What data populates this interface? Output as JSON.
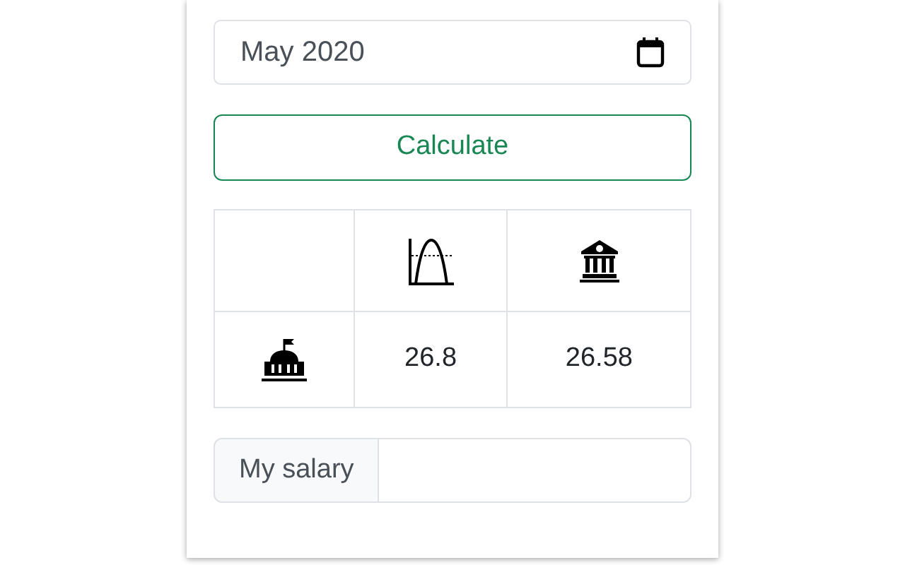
{
  "date_field": {
    "value": "May 2020"
  },
  "calculate_button": {
    "label": "Calculate"
  },
  "table": {
    "columns": [
      {
        "kind": "blank"
      },
      {
        "kind": "chart"
      },
      {
        "kind": "bank"
      }
    ],
    "rows": [
      {
        "kind": "capitol",
        "cells": [
          "26.8",
          "26.58"
        ]
      }
    ]
  },
  "salary": {
    "label": "My salary"
  }
}
